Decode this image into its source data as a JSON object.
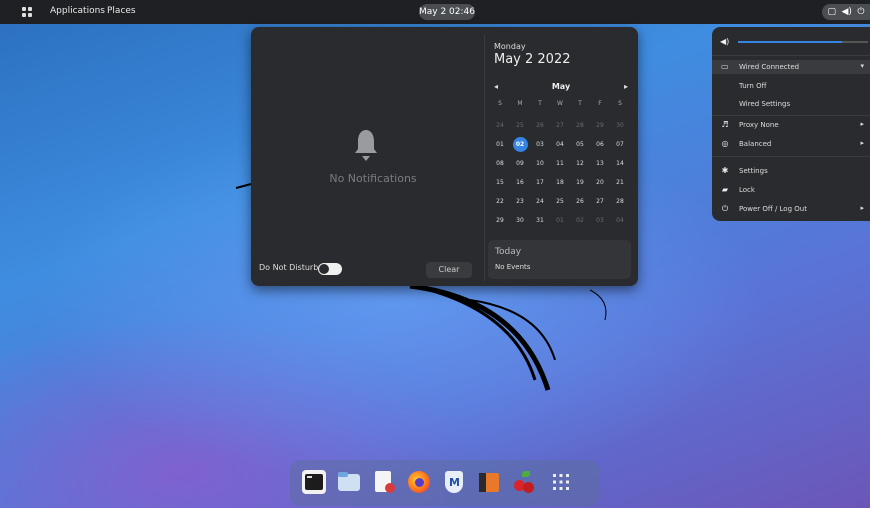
{
  "topbar": {
    "applications": "Applications",
    "places": "Places",
    "clock": "May 2 02:46"
  },
  "notifications": {
    "empty_text": "No Notifications",
    "dnd_label": "Do Not Disturb",
    "clear_label": "Clear"
  },
  "calendar": {
    "weekday": "Monday",
    "date": "May 2 2022",
    "month": "May",
    "prev": "◂",
    "next": "▸",
    "days_of_week": [
      "S",
      "M",
      "T",
      "W",
      "T",
      "F",
      "S"
    ],
    "rows": [
      [
        "24",
        "25",
        "26",
        "27",
        "28",
        "29",
        "30"
      ],
      [
        "01",
        "02",
        "03",
        "04",
        "05",
        "06",
        "07"
      ],
      [
        "08",
        "09",
        "10",
        "11",
        "12",
        "13",
        "14"
      ],
      [
        "15",
        "16",
        "17",
        "18",
        "19",
        "20",
        "21"
      ],
      [
        "22",
        "23",
        "24",
        "25",
        "26",
        "27",
        "28"
      ],
      [
        "29",
        "30",
        "31",
        "01",
        "02",
        "03",
        "04"
      ]
    ],
    "today_label": "Today",
    "no_events": "No Events"
  },
  "system_menu": {
    "volume_level": 0.8,
    "wired": "Wired Connected",
    "turn_off": "Turn Off",
    "wired_settings": "Wired Settings",
    "proxy": "Proxy None",
    "power_mode": "Balanced",
    "settings": "Settings",
    "lock": "Lock",
    "power": "Power Off / Log Out"
  },
  "colors": {
    "accent": "#3584e4"
  }
}
